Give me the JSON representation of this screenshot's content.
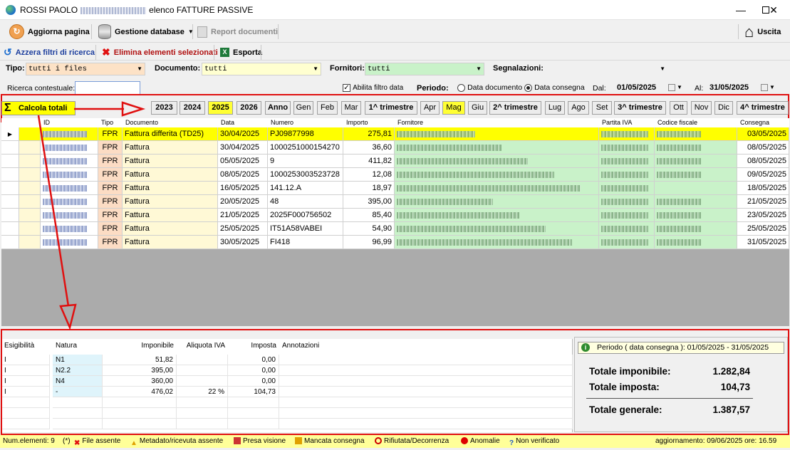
{
  "window": {
    "title_prefix": "ROSSI PAOLO",
    "title_suffix": "elenco FATTURE PASSIVE"
  },
  "toolbar": {
    "refresh": "Aggiorna pagina",
    "db": "Gestione database",
    "report": "Report documenti",
    "exit": "Uscita"
  },
  "toolbar2": {
    "reset": "Azzera filtri di ricerca",
    "delete": "Elimina elementi selezionati",
    "export": "Esporta"
  },
  "filters": {
    "tipo_label": "Tipo:",
    "tipo_value": "tutti i files",
    "doc_label": "Documento:",
    "doc_value": "tutti",
    "forn_label": "Fornitori:",
    "forn_value": "tutti",
    "segn_label": "Segnalazioni:",
    "segn_value": ""
  },
  "search": {
    "label": "Ricerca contestuale:",
    "date_filter": "Abilita filtro data",
    "period_label": "Periodo:",
    "opt_doc": "Data documento",
    "opt_cons": "Data consegna",
    "from_label": "Dal:",
    "from_value": "01/05/2025",
    "to_label": "Al:",
    "to_value": "31/05/2025"
  },
  "periods": {
    "calc": "Calcola totali",
    "buttons": [
      "2023",
      "2024",
      "2025",
      "2026",
      "Anno",
      "Gen",
      "Feb",
      "Mar",
      "1^ trimestre",
      "Apr",
      "Mag",
      "Giu",
      "2^ trimestre",
      "Lug",
      "Ago",
      "Set",
      "3^ trimestre",
      "Ott",
      "Nov",
      "Dic",
      "4^ trimestre"
    ]
  },
  "grid": {
    "headers": [
      "ID",
      "Tipo",
      "Documento",
      "Data",
      "Numero",
      "Importo",
      "Fornitore",
      "Partita IVA",
      "Codice fiscale",
      "Consegna"
    ],
    "rows": [
      [
        "FPR",
        "Fattura differita (TD25)",
        "30/04/2025",
        "PJ09877998",
        "275,81",
        "03/05/2025"
      ],
      [
        "FPR",
        "Fattura",
        "30/04/2025",
        "1000251000154270",
        "36,60",
        "08/05/2025"
      ],
      [
        "FPR",
        "Fattura",
        "05/05/2025",
        "9",
        "411,82",
        "08/05/2025"
      ],
      [
        "FPR",
        "Fattura",
        "08/05/2025",
        "1000253003523728",
        "12,08",
        "09/05/2025"
      ],
      [
        "FPR",
        "Fattura",
        "16/05/2025",
        "141.12.A",
        "18,97",
        "18/05/2025"
      ],
      [
        "FPR",
        "Fattura",
        "20/05/2025",
        "48",
        "395,00",
        "21/05/2025"
      ],
      [
        "FPR",
        "Fattura",
        "21/05/2025",
        "2025F000756502",
        "85,40",
        "23/05/2025"
      ],
      [
        "FPR",
        "Fattura",
        "25/05/2025",
        "IT51A58VABEI",
        "54,90",
        "25/05/2025"
      ],
      [
        "FPR",
        "Fattura",
        "30/05/2025",
        "FI418",
        "96,99",
        "31/05/2025"
      ]
    ]
  },
  "vat": {
    "headers": [
      "Esigibilità",
      "Natura",
      "Imponibile",
      "Aliquota IVA",
      "Imposta",
      "Annotazioni"
    ],
    "rows": [
      [
        "I",
        "N1",
        "51,82",
        "",
        "0,00",
        ""
      ],
      [
        "I",
        "N2.2",
        "395,00",
        "",
        "0,00",
        ""
      ],
      [
        "I",
        "N4",
        "360,00",
        "",
        "0,00",
        ""
      ],
      [
        "I",
        "-",
        "476,02",
        "22 %",
        "104,73",
        ""
      ]
    ]
  },
  "totals": {
    "period": "Periodo ( data consegna ): 01/05/2025  -  31/05/2025",
    "imponibile_label": "Totale imponibile:",
    "imponibile": "1.282,84",
    "imposta_label": "Totale imposta:",
    "imposta": "104,73",
    "generale_label": "Totale generale:",
    "generale": "1.387,57"
  },
  "status": {
    "count": "Num.elementi: 9",
    "star": "(*)",
    "file_absent": "File assente",
    "meta_absent": "Metadato/ricevuta assente",
    "presa": "Presa visione",
    "mancata": "Mancata consegna",
    "rifiutata": "Rifiutata/Decorrenza",
    "anomalie": "Anomalie",
    "non_ver": "Non verificato",
    "update": "aggiornamento: 09/06/2025  ore: 16.59"
  }
}
